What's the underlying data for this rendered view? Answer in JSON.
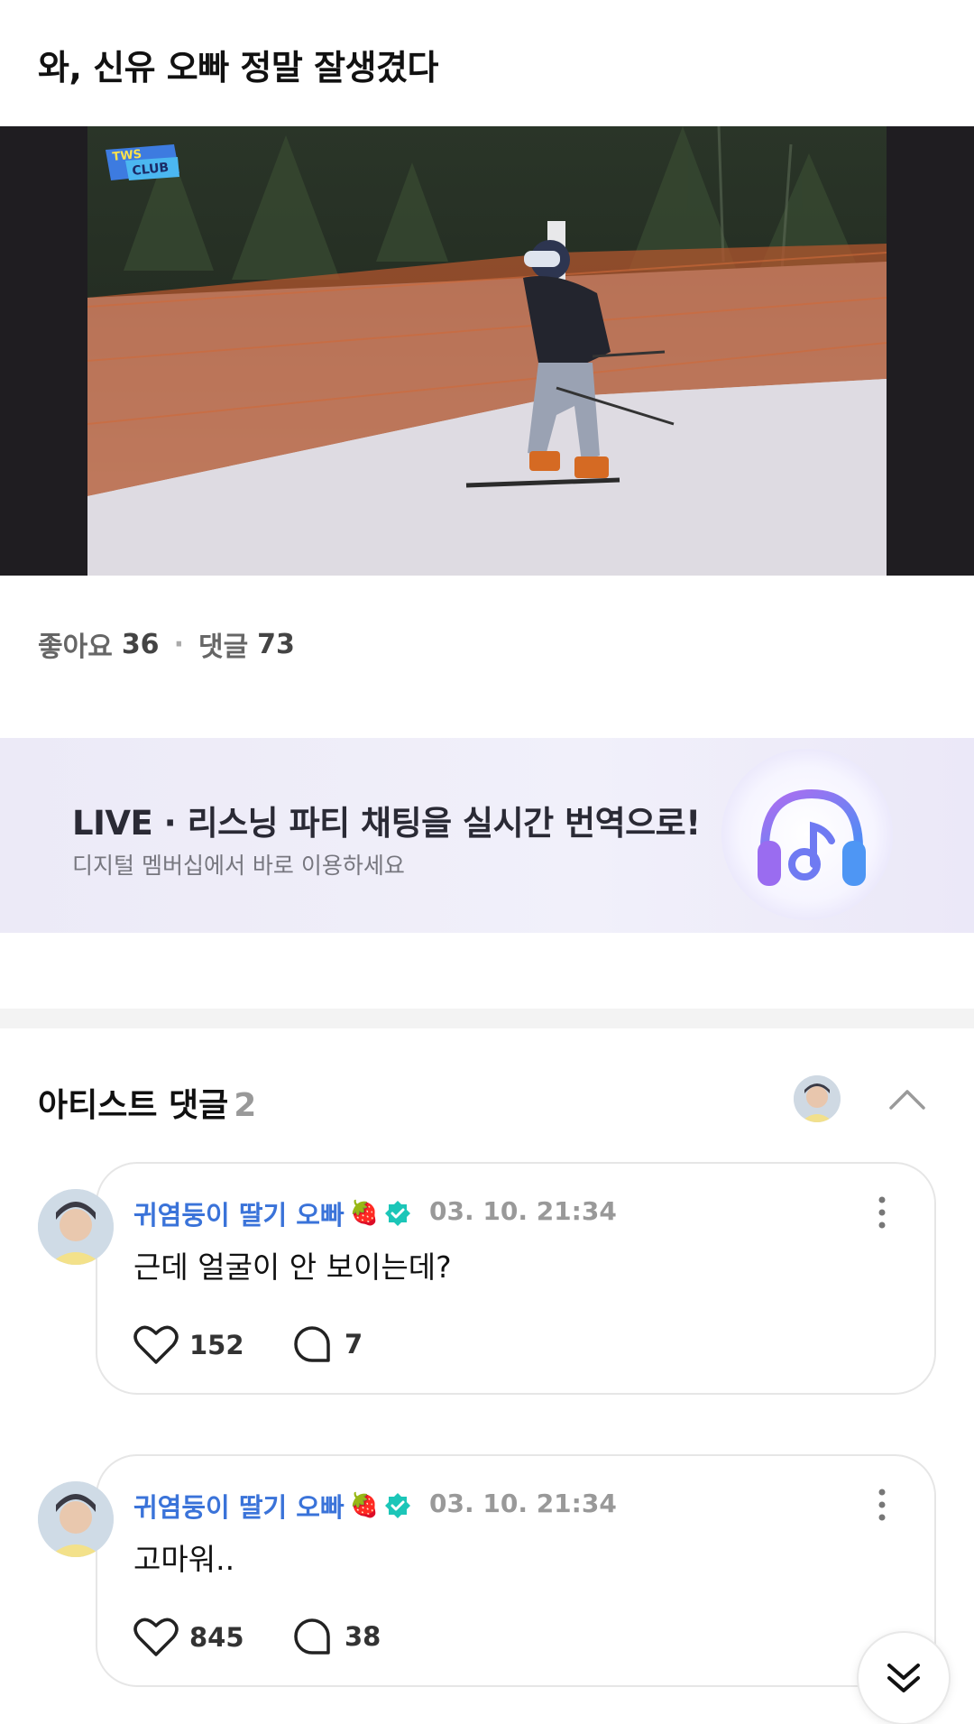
{
  "post": {
    "title": "와, 신유 오빠 정말 잘생겼다",
    "media_logo_text": "TWS CLUB",
    "stats": {
      "likes_label": "좋아요",
      "likes_count": "36",
      "separator": "·",
      "comments_label": "댓글",
      "comments_count": "73"
    }
  },
  "banner": {
    "title": "LIVE · 리스닝 파티 채팅을 실시간 번역으로!",
    "subtitle": "디지털 멤버십에서 바로 이용하세요",
    "icon": "headphones-music-icon"
  },
  "artist_comments": {
    "label": "아티스트 댓글",
    "count": "2",
    "collapse_icon": "chevron-up-icon",
    "items": [
      {
        "author": "귀염둥이 딸기 오빠",
        "author_emoji": "🍓",
        "verified_icon": "verified-badge-icon",
        "time": "03. 10. 21:34",
        "text": "근데 얼굴이 안 보이는데?",
        "likes": "152",
        "replies": "7"
      },
      {
        "author": "귀염둥이 딸기 오빠",
        "author_emoji": "🍓",
        "verified_icon": "verified-badge-icon",
        "time": "03. 10. 21:34",
        "text": "고마워..",
        "likes": "845",
        "replies": "38"
      }
    ]
  },
  "colors": {
    "author_name": "#3a73d9",
    "verified": "#1cc6b8",
    "banner_bg": "#eceaf7",
    "muted_text": "#999999"
  },
  "scroll_icon": "double-chevron-down-icon"
}
